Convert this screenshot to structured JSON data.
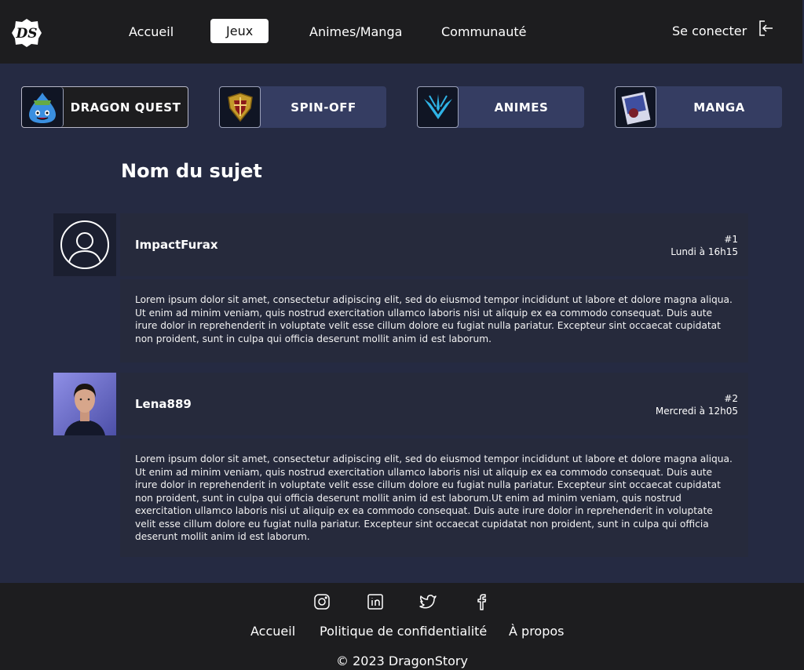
{
  "header": {
    "logo_text": "DS",
    "nav": [
      "Accueil",
      "Jeux",
      "Animes/Manga",
      "Communauté"
    ],
    "login_label": "Se conecter"
  },
  "categories": [
    "DRAGON QUEST",
    "SPIN-OFF",
    "ANIMES",
    "MANGA"
  ],
  "topic": {
    "title": "Nom du sujet"
  },
  "posts": [
    {
      "user": "ImpactFurax",
      "number": "#1",
      "date": "Lundi à 16h15",
      "avatar": "default-user-icon",
      "body": "Lorem ipsum dolor sit amet, consectetur adipiscing elit, sed do eiusmod tempor incididunt ut labore et dolore magna aliqua. Ut enim ad minim veniam, quis nostrud exercitation ullamco laboris nisi ut aliquip ex ea commodo consequat. Duis aute irure dolor in reprehenderit in voluptate velit esse cillum dolore eu fugiat nulla pariatur. Excepteur sint occaecat cupidatat non proident, sunt in culpa qui officia deserunt mollit anim id est laborum."
    },
    {
      "user": "Lena889",
      "number": "#2",
      "date": "Mercredi à 12h05",
      "avatar": "photo",
      "body": "Lorem ipsum dolor sit amet, consectetur adipiscing elit, sed do eiusmod tempor incididunt ut labore et dolore magna aliqua. Ut enim ad minim veniam, quis nostrud exercitation ullamco laboris nisi ut aliquip ex ea commodo consequat. Duis aute irure dolor in reprehenderit in voluptate velit esse cillum dolore eu fugiat nulla pariatur. Excepteur sint occaecat cupidatat non proident, sunt in culpa qui officia deserunt mollit anim id est laborum.Ut enim ad minim veniam, quis nostrud exercitation ullamco laboris nisi ut aliquip ex ea commodo consequat. Duis aute irure dolor in reprehenderit in voluptate velit esse cillum dolore eu fugiat nulla pariatur. Excepteur sint occaecat cupidatat non proident, sunt in culpa qui officia deserunt mollit anim id est laborum."
    }
  ],
  "footer": {
    "social_icons": [
      "instagram-icon",
      "linkedin-icon",
      "twitter-icon",
      "facebook-icon"
    ],
    "links": [
      "Accueil",
      "Politique de confidentialité",
      "À propos"
    ],
    "copyright": "© 2023 DragonStory"
  },
  "colors": {
    "page_bg": "#252a42",
    "header_bg": "#1d1d1f",
    "category_bg": "#353d62",
    "post_bg": "#262a3c"
  }
}
